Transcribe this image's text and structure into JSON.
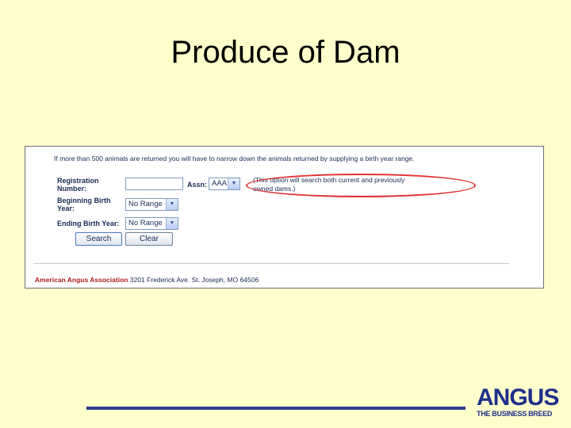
{
  "slide": {
    "title": "Produce of Dam"
  },
  "form": {
    "notice": "If more than 500 animals are returned you will have to narrow down the animals returned by supplying a birth year range.",
    "registration_label_1": "Registration",
    "registration_label_2": "Number:",
    "registration_value": "",
    "assn_label": "Assn:",
    "assn_selected": "AAA",
    "note_line_1": "(This option will search both current and previously",
    "note_line_2": "owned dams.)",
    "beginning_label_1": "Beginning Birth",
    "beginning_label_2": "Year:",
    "beginning_selected": "No Range",
    "ending_label": "Ending Birth Year:",
    "ending_selected": "No Range",
    "search_label": "Search",
    "clear_label": "Clear"
  },
  "footer": {
    "org": "American Angus Association",
    "address": " 3201 Frederick Ave. St. Joseph, MO 64506"
  },
  "logo": {
    "word": "ANGUS",
    "tagline": "THE BUSINESS BREED"
  },
  "colors": {
    "background": "#FFFFCC",
    "accent_rule": "#2D3E91",
    "highlight_oval": "#E03030",
    "logo": "#1E2F8A"
  },
  "icons": {
    "dropdown": "chevron-down-icon"
  }
}
